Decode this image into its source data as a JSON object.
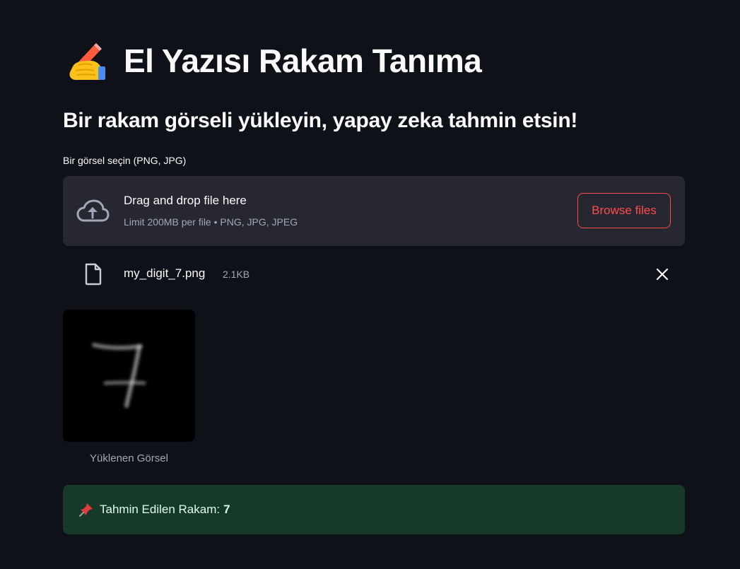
{
  "header": {
    "title": "El Yazısı Rakam Tanıma",
    "title_icon": "writing-hand-icon",
    "subtitle": "Bir rakam görseli yükleyin, yapay zeka tahmin etsin!"
  },
  "uploader": {
    "label": "Bir görsel seçin (PNG, JPG)",
    "drop_title": "Drag and drop file here",
    "drop_subtitle": "Limit 200MB per file • PNG, JPG, JPEG",
    "browse_label": "Browse files",
    "accent_color": "#ff4b4b",
    "icons": [
      "cloud-upload-icon",
      "file-icon",
      "close-icon"
    ]
  },
  "uploaded_file": {
    "name": "my_digit_7.png",
    "size": "2.1KB"
  },
  "image": {
    "caption": "Yüklenen Görsel",
    "depicted_digit": "7"
  },
  "result": {
    "icon": "pushpin-icon",
    "label": "Tahmin Edilen Rakam:",
    "value": "7",
    "background_color": "#173928"
  },
  "theme": {
    "background": "#0e1117",
    "panel": "#262730",
    "text": "#fafafa",
    "muted_text": "#a3a8b8"
  }
}
